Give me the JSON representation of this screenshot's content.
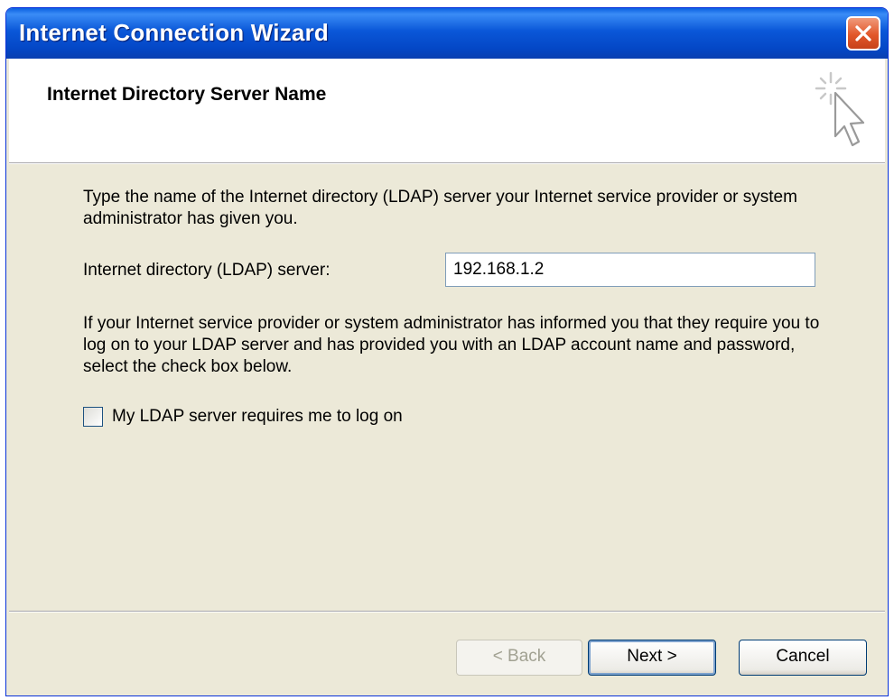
{
  "window": {
    "title": "Internet Connection Wizard",
    "close_icon": "close-icon"
  },
  "header": {
    "title": "Internet Directory Server Name",
    "icon": "wizard-cursor-icon"
  },
  "content": {
    "description1": "Type the name of the Internet directory (LDAP) server your Internet service provider or system administrator has given you.",
    "server_label": "Internet directory (LDAP) server:",
    "server_value": "192.168.1.2",
    "description2": "If your Internet service provider or system administrator has informed you that they require you to log on to your LDAP server and has provided you with an LDAP account name and password, select the check box below.",
    "checkbox_label": "My LDAP server requires me to log on",
    "checkbox_checked": false
  },
  "buttons": {
    "back": "< Back",
    "next": "Next >",
    "cancel": "Cancel"
  },
  "colors": {
    "titlebar": "#0a57d8",
    "dialog_bg": "#ece9d8",
    "close_button": "#e2572a"
  }
}
